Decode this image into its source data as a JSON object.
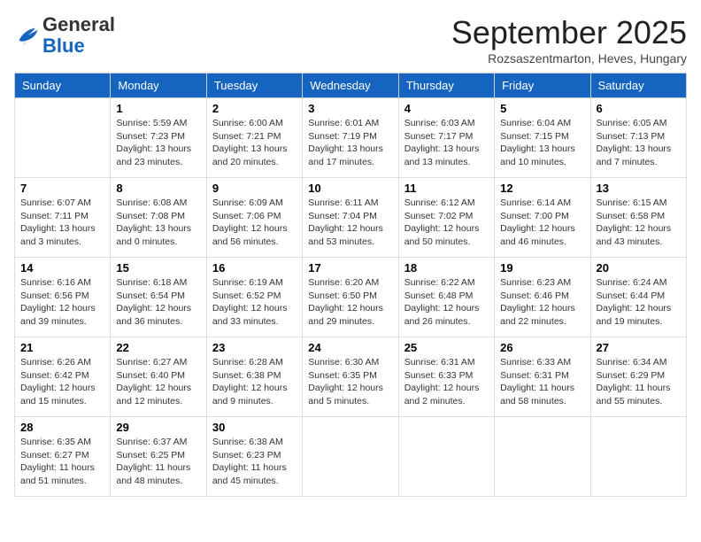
{
  "header": {
    "logo_general": "General",
    "logo_blue": "Blue",
    "month_title": "September 2025",
    "subtitle": "Rozsaszentmarton, Heves, Hungary"
  },
  "weekdays": [
    "Sunday",
    "Monday",
    "Tuesday",
    "Wednesday",
    "Thursday",
    "Friday",
    "Saturday"
  ],
  "weeks": [
    [
      {
        "day": "",
        "info": ""
      },
      {
        "day": "1",
        "info": "Sunrise: 5:59 AM\nSunset: 7:23 PM\nDaylight: 13 hours\nand 23 minutes."
      },
      {
        "day": "2",
        "info": "Sunrise: 6:00 AM\nSunset: 7:21 PM\nDaylight: 13 hours\nand 20 minutes."
      },
      {
        "day": "3",
        "info": "Sunrise: 6:01 AM\nSunset: 7:19 PM\nDaylight: 13 hours\nand 17 minutes."
      },
      {
        "day": "4",
        "info": "Sunrise: 6:03 AM\nSunset: 7:17 PM\nDaylight: 13 hours\nand 13 minutes."
      },
      {
        "day": "5",
        "info": "Sunrise: 6:04 AM\nSunset: 7:15 PM\nDaylight: 13 hours\nand 10 minutes."
      },
      {
        "day": "6",
        "info": "Sunrise: 6:05 AM\nSunset: 7:13 PM\nDaylight: 13 hours\nand 7 minutes."
      }
    ],
    [
      {
        "day": "7",
        "info": "Sunrise: 6:07 AM\nSunset: 7:11 PM\nDaylight: 13 hours\nand 3 minutes."
      },
      {
        "day": "8",
        "info": "Sunrise: 6:08 AM\nSunset: 7:08 PM\nDaylight: 13 hours\nand 0 minutes."
      },
      {
        "day": "9",
        "info": "Sunrise: 6:09 AM\nSunset: 7:06 PM\nDaylight: 12 hours\nand 56 minutes."
      },
      {
        "day": "10",
        "info": "Sunrise: 6:11 AM\nSunset: 7:04 PM\nDaylight: 12 hours\nand 53 minutes."
      },
      {
        "day": "11",
        "info": "Sunrise: 6:12 AM\nSunset: 7:02 PM\nDaylight: 12 hours\nand 50 minutes."
      },
      {
        "day": "12",
        "info": "Sunrise: 6:14 AM\nSunset: 7:00 PM\nDaylight: 12 hours\nand 46 minutes."
      },
      {
        "day": "13",
        "info": "Sunrise: 6:15 AM\nSunset: 6:58 PM\nDaylight: 12 hours\nand 43 minutes."
      }
    ],
    [
      {
        "day": "14",
        "info": "Sunrise: 6:16 AM\nSunset: 6:56 PM\nDaylight: 12 hours\nand 39 minutes."
      },
      {
        "day": "15",
        "info": "Sunrise: 6:18 AM\nSunset: 6:54 PM\nDaylight: 12 hours\nand 36 minutes."
      },
      {
        "day": "16",
        "info": "Sunrise: 6:19 AM\nSunset: 6:52 PM\nDaylight: 12 hours\nand 33 minutes."
      },
      {
        "day": "17",
        "info": "Sunrise: 6:20 AM\nSunset: 6:50 PM\nDaylight: 12 hours\nand 29 minutes."
      },
      {
        "day": "18",
        "info": "Sunrise: 6:22 AM\nSunset: 6:48 PM\nDaylight: 12 hours\nand 26 minutes."
      },
      {
        "day": "19",
        "info": "Sunrise: 6:23 AM\nSunset: 6:46 PM\nDaylight: 12 hours\nand 22 minutes."
      },
      {
        "day": "20",
        "info": "Sunrise: 6:24 AM\nSunset: 6:44 PM\nDaylight: 12 hours\nand 19 minutes."
      }
    ],
    [
      {
        "day": "21",
        "info": "Sunrise: 6:26 AM\nSunset: 6:42 PM\nDaylight: 12 hours\nand 15 minutes."
      },
      {
        "day": "22",
        "info": "Sunrise: 6:27 AM\nSunset: 6:40 PM\nDaylight: 12 hours\nand 12 minutes."
      },
      {
        "day": "23",
        "info": "Sunrise: 6:28 AM\nSunset: 6:38 PM\nDaylight: 12 hours\nand 9 minutes."
      },
      {
        "day": "24",
        "info": "Sunrise: 6:30 AM\nSunset: 6:35 PM\nDaylight: 12 hours\nand 5 minutes."
      },
      {
        "day": "25",
        "info": "Sunrise: 6:31 AM\nSunset: 6:33 PM\nDaylight: 12 hours\nand 2 minutes."
      },
      {
        "day": "26",
        "info": "Sunrise: 6:33 AM\nSunset: 6:31 PM\nDaylight: 11 hours\nand 58 minutes."
      },
      {
        "day": "27",
        "info": "Sunrise: 6:34 AM\nSunset: 6:29 PM\nDaylight: 11 hours\nand 55 minutes."
      }
    ],
    [
      {
        "day": "28",
        "info": "Sunrise: 6:35 AM\nSunset: 6:27 PM\nDaylight: 11 hours\nand 51 minutes."
      },
      {
        "day": "29",
        "info": "Sunrise: 6:37 AM\nSunset: 6:25 PM\nDaylight: 11 hours\nand 48 minutes."
      },
      {
        "day": "30",
        "info": "Sunrise: 6:38 AM\nSunset: 6:23 PM\nDaylight: 11 hours\nand 45 minutes."
      },
      {
        "day": "",
        "info": ""
      },
      {
        "day": "",
        "info": ""
      },
      {
        "day": "",
        "info": ""
      },
      {
        "day": "",
        "info": ""
      }
    ]
  ]
}
